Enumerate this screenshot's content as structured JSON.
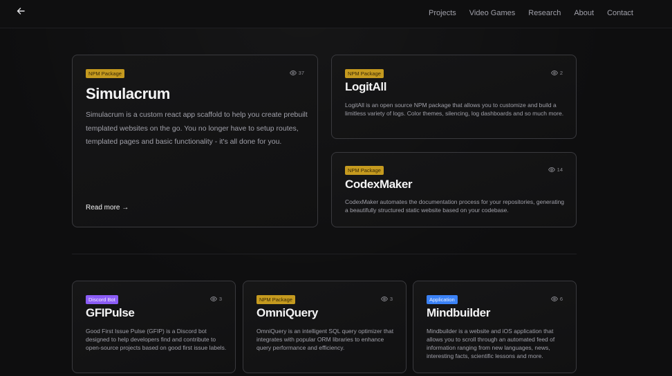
{
  "nav": {
    "links": [
      "Projects",
      "Video Games",
      "Research",
      "About",
      "Contact"
    ]
  },
  "featured": {
    "badge": "NPM Package",
    "views": "37",
    "title": "Simulacrum",
    "description": "Simulacrum is a custom react app scaffold to help you create prebuilt templated websites on the go. You no longer have to setup routes, templated pages and basic functionality - it's all done for you.",
    "read_more": "Read more →"
  },
  "side_cards": [
    {
      "badge": "NPM Package",
      "views": "2",
      "title": "LogitAll",
      "description": "LogitAll is an open source NPM package that allows you to customize and build a limitless variety of logs. Color themes, silencing, log dashboards and so much more."
    },
    {
      "badge": "NPM Package",
      "views": "14",
      "title": "CodexMaker",
      "description": "CodexMaker automates the documentation process for your repositories, generating a beautifully structured static website based on your codebase."
    }
  ],
  "bottom_cards": [
    {
      "badge": "Discord Bot",
      "views": "3",
      "title": "GFIPulse",
      "description": "Good First Issue Pulse (GFIP) is a Discord bot designed to help developers find and contribute to open-source projects based on good first issue labels."
    },
    {
      "badge": "NPM Package",
      "views": "3",
      "title": "OmniQuery",
      "description": "OmniQuery is an intelligent SQL query optimizer that integrates with popular ORM libraries to enhance query performance and efficiency."
    },
    {
      "badge": "Application",
      "views": "6",
      "title": "Mindbuilder",
      "description": "Mindbuilder is a website and iOS application that allows you to scroll through an automated feed of information ranging from new languages, news, interesting facts, scientific lessons and more."
    }
  ],
  "colors": {
    "npm_badge": "#c59a1f",
    "discord_badge": "#8b5cf6",
    "app_badge": "#3b82f6",
    "background": "#0e0e0f"
  }
}
